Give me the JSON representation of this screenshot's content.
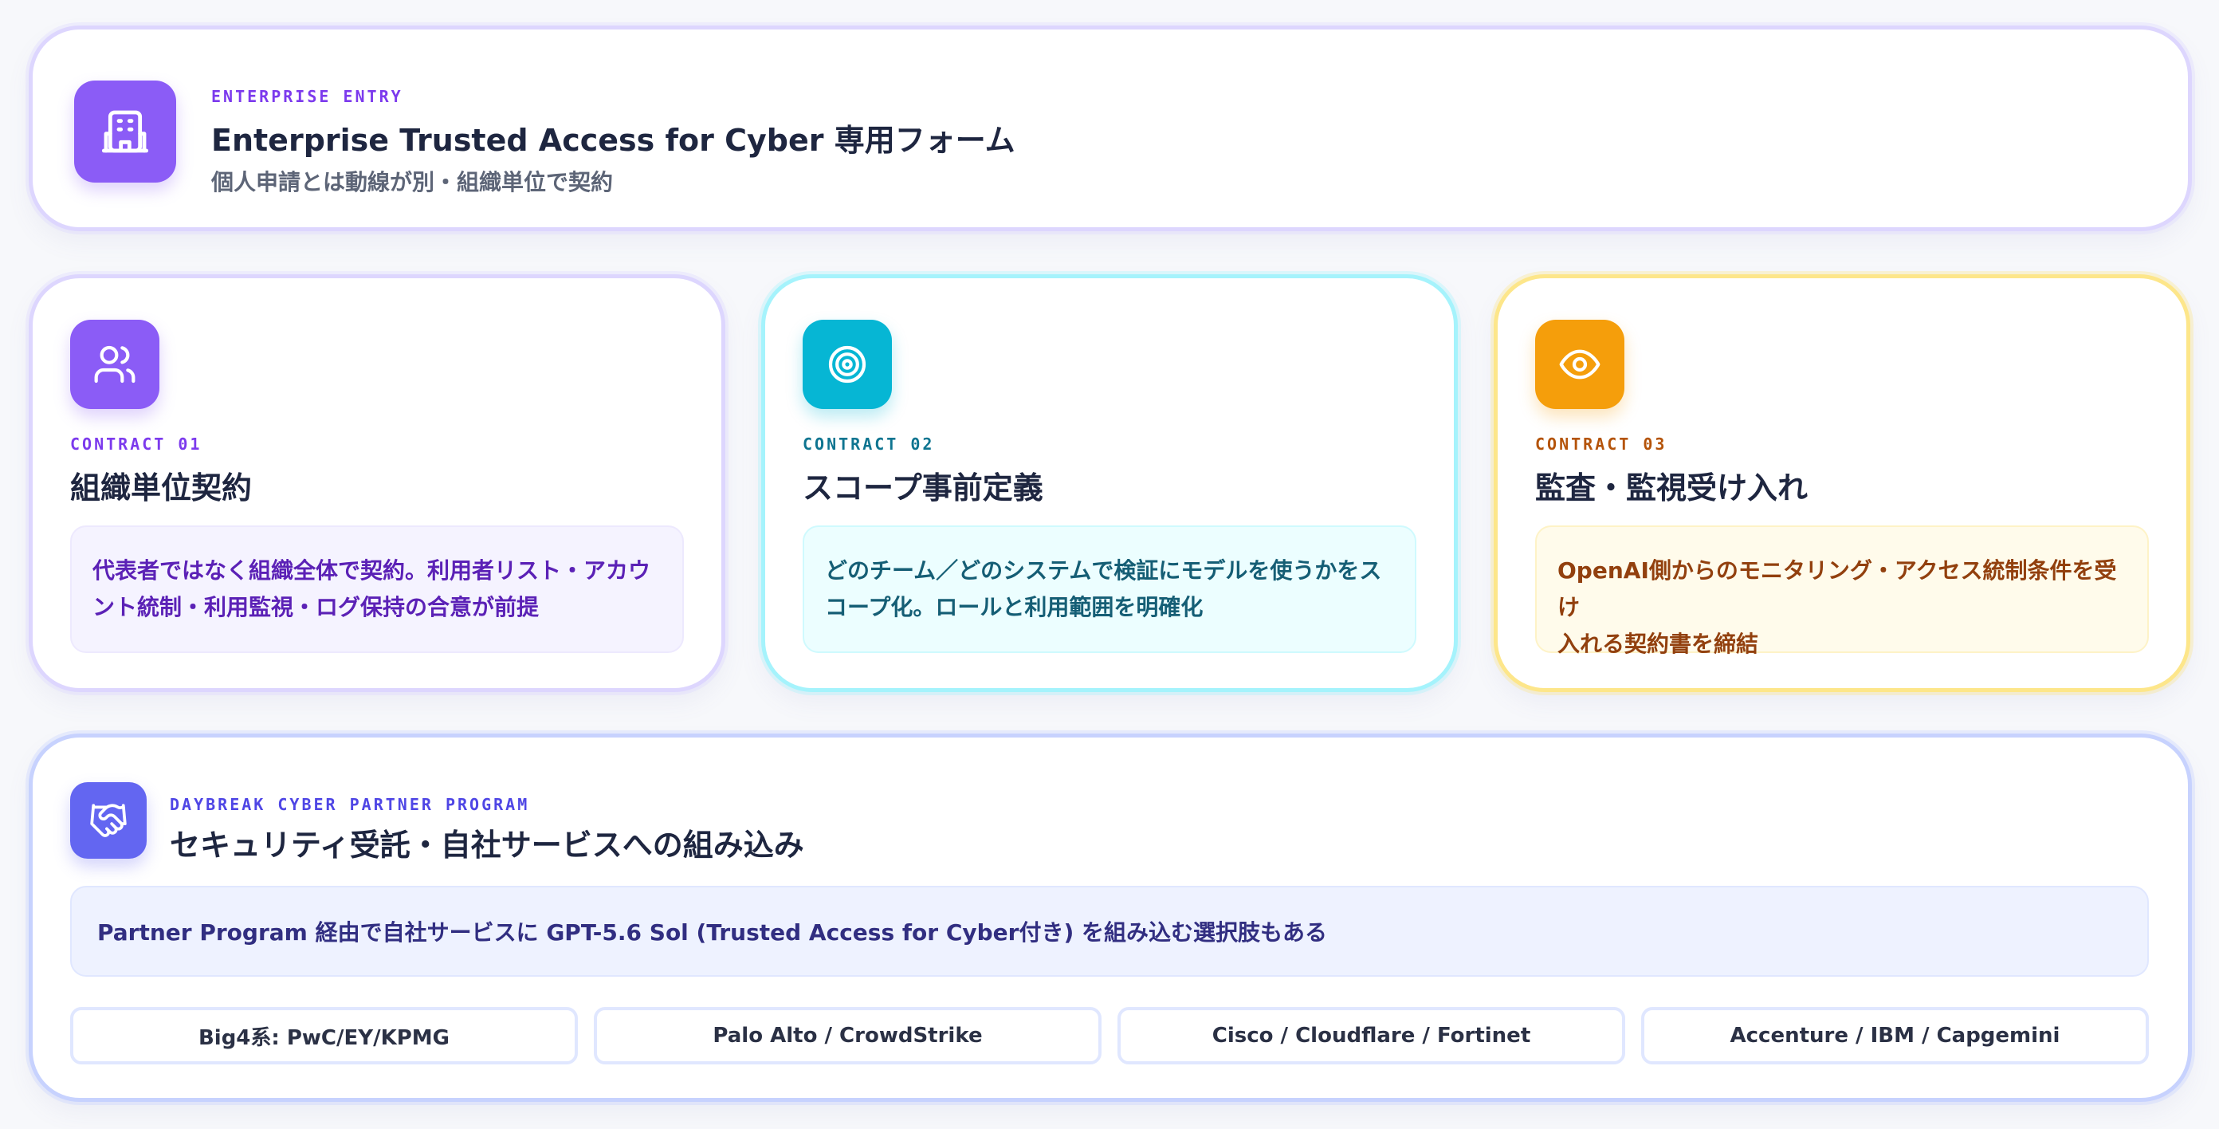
{
  "header": {
    "icon": "building-icon",
    "kicker": "ENTERPRISE ENTRY",
    "title": "Enterprise Trusted Access for Cyber 専用フォーム",
    "subtitle": "個人申請とは動線が別・組織単位で契約"
  },
  "contracts": [
    {
      "icon": "users-icon",
      "kicker": "CONTRACT 01",
      "title": "組織単位契約",
      "description_line1": "代表者ではなく組織全体で契約。利用者リスト・アカウ",
      "description_line2": "ント統制・利用監視・ログ保持の合意が前提",
      "accent": "#8b5cf6"
    },
    {
      "icon": "target-icon",
      "kicker": "CONTRACT 02",
      "title": "スコープ事前定義",
      "description_line1": "どのチーム／どのシステムで検証にモデルを使うかをス",
      "description_line2": "コープ化。ロールと利用範囲を明確化",
      "accent": "#06b6d4"
    },
    {
      "icon": "eye-icon",
      "kicker": "CONTRACT 03",
      "title": "監査・監視受け入れ",
      "description_line1": "OpenAI側からのモニタリング・アクセス統制条件を受け",
      "description_line2": "入れる契約書を締結",
      "accent": "#f59e0b"
    }
  ],
  "partner": {
    "icon": "handshake-icon",
    "kicker": "DAYBREAK CYBER PARTNER PROGRAM",
    "title": "セキュリティ受託・自社サービスへの組み込み",
    "note": "Partner Program 経由で自社サービスに GPT-5.6 Sol (Trusted Access for Cyber付き) を組み込む選択肢もある",
    "chips": [
      "Big4系: PwC/EY/KPMG",
      "Palo Alto / CrowdStrike",
      "Cisco / Cloudflare / Fortinet",
      "Accenture / IBM / Capgemini"
    ],
    "accent": "#6366f1"
  }
}
